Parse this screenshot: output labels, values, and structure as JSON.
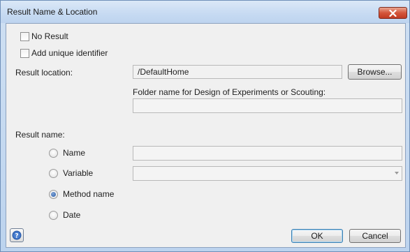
{
  "window": {
    "title": "Result Name & Location"
  },
  "options": {
    "no_result": {
      "label": "No Result",
      "checked": false
    },
    "unique_id": {
      "label": "Add unique identifier",
      "checked": false
    }
  },
  "location": {
    "label": "Result location:",
    "value": "/DefaultHome",
    "browse_label": "Browse...",
    "folder_label": "Folder name for Design of Experiments or Scouting:",
    "folder_value": ""
  },
  "result_name": {
    "label": "Result name:",
    "options": [
      {
        "label": "Name",
        "checked": false
      },
      {
        "label": "Variable",
        "checked": false
      },
      {
        "label": "Method name",
        "checked": true
      },
      {
        "label": "Date",
        "checked": false
      }
    ],
    "name_value": "",
    "variable_value": ""
  },
  "footer": {
    "help_icon": "help-icon",
    "ok_label": "OK",
    "cancel_label": "Cancel"
  }
}
